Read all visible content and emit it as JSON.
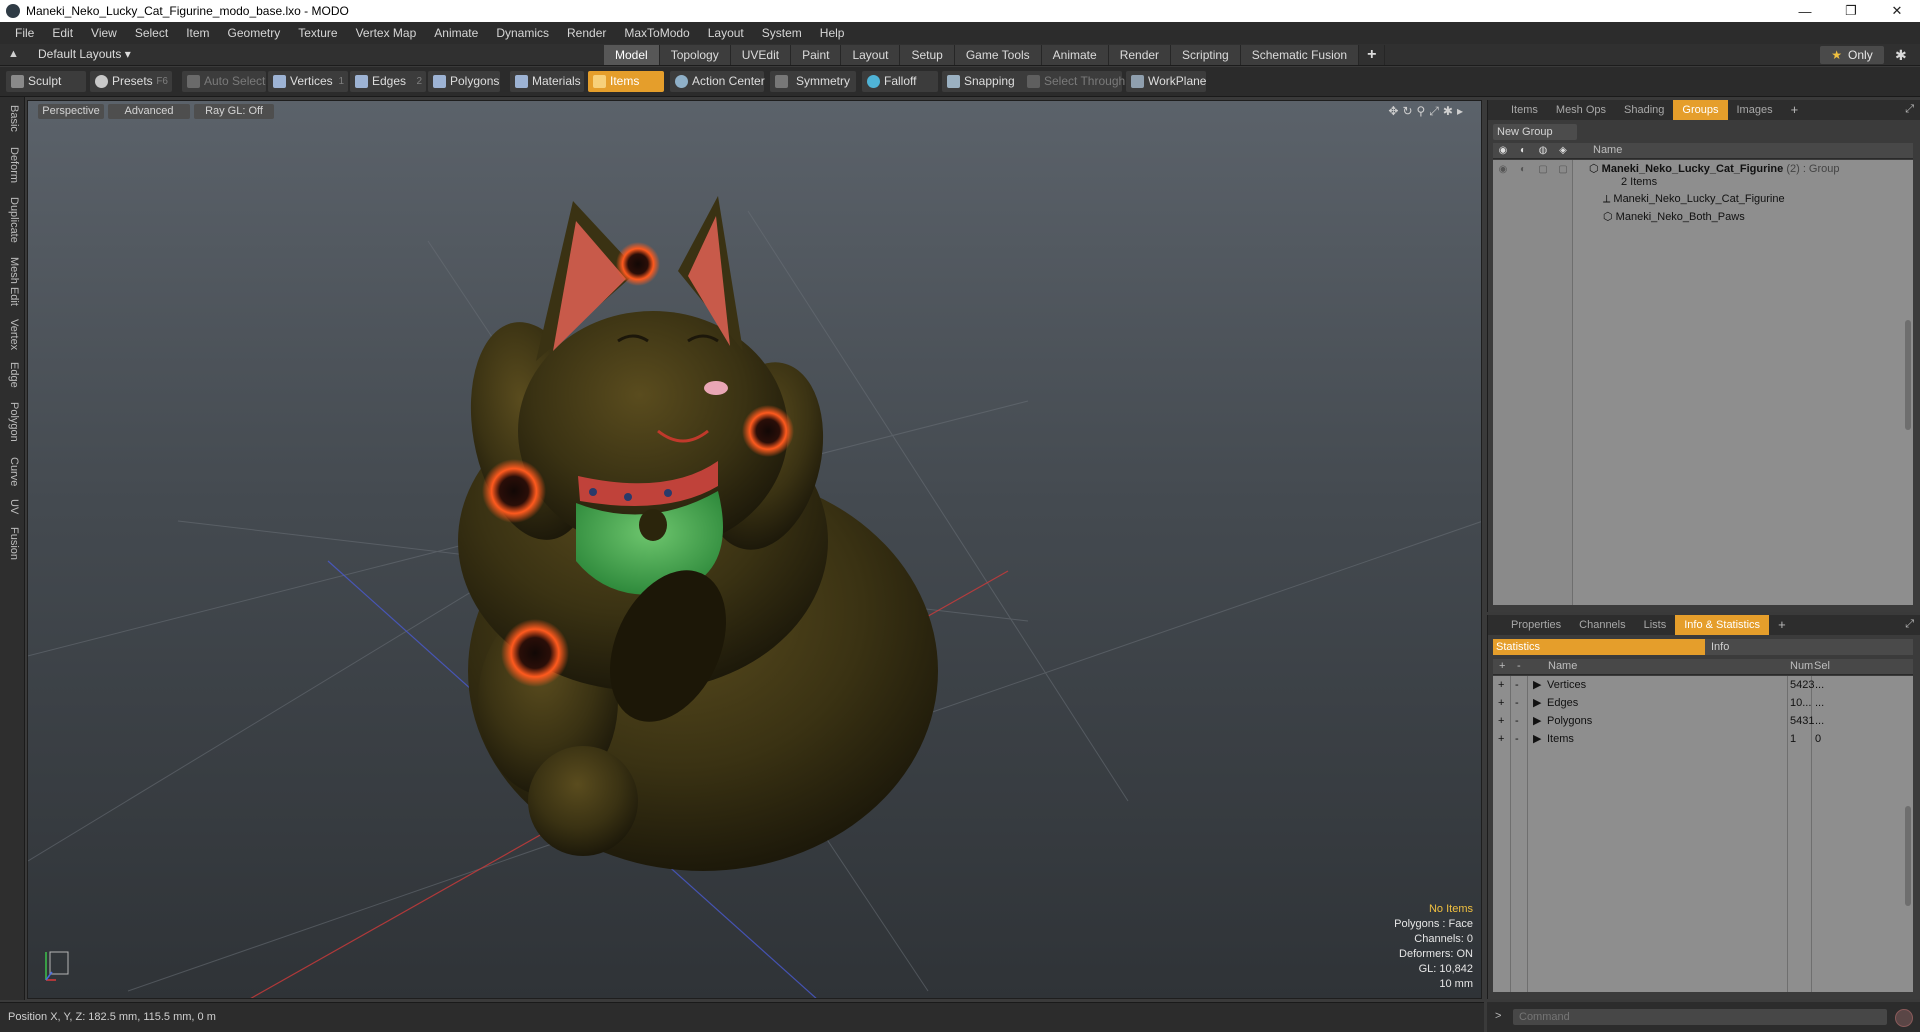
{
  "window": {
    "title": "Maneki_Neko_Lucky_Cat_Figurine_modo_base.lxo - MODO",
    "controls": [
      "—",
      "❐",
      "✕"
    ]
  },
  "menu": [
    "File",
    "Edit",
    "View",
    "Select",
    "Item",
    "Geometry",
    "Texture",
    "Vertex Map",
    "Animate",
    "Dynamics",
    "Render",
    "MaxToModo",
    "Layout",
    "System",
    "Help"
  ],
  "layoutbar": {
    "layout_dropdown": "Default Layouts ▾",
    "tabs": [
      "Model",
      "Topology",
      "UVEdit",
      "Paint",
      "Layout",
      "Setup",
      "Game Tools",
      "Animate",
      "Render",
      "Scripting",
      "Schematic Fusion"
    ],
    "active_tab": "Model",
    "add_tab": "+",
    "only_label": "Only"
  },
  "toolbar": {
    "sculpt": "Sculpt",
    "presets": "Presets",
    "presets_key": "F6",
    "auto_select": "Auto Select",
    "vertices": "Vertices",
    "vertices_key": "1",
    "edges": "Edges",
    "edges_key": "2",
    "polygons": "Polygons",
    "materials": "Materials",
    "items": "Items",
    "action_center": "Action Center",
    "symmetry": "Symmetry",
    "falloff": "Falloff",
    "snapping": "Snapping",
    "select_through": "Select Through",
    "workplane": "WorkPlane"
  },
  "left_tabs": [
    "Basic",
    "Deform",
    "Duplicate",
    "Mesh Edit",
    "Vertex",
    "Edge",
    "Polygon",
    "Curve",
    "UV",
    "Fusion"
  ],
  "viewport": {
    "view_mode": "Perspective",
    "shading": "Advanced",
    "raygl": "Ray GL: Off",
    "overlay": {
      "no_items": "No Items",
      "polygons": "Polygons : Face",
      "channels": "Channels: 0",
      "deformers": "Deformers: ON",
      "gl": "GL: 10,842",
      "scale": "10 mm"
    }
  },
  "groups_panel": {
    "tabs": [
      "Items",
      "Mesh Ops",
      "Shading",
      "Groups",
      "Images"
    ],
    "active_tab": "Groups",
    "add_tab": "+",
    "new_group": "New Group",
    "column_name": "Name",
    "rows": [
      {
        "name": "Maneki_Neko_Lucky_Cat_Figurine",
        "suffix": "(2) : Group",
        "sub": "2 Items"
      },
      {
        "name": "Maneki_Neko_Lucky_Cat_Figurine"
      },
      {
        "name": "Maneki_Neko_Both_Paws"
      }
    ]
  },
  "stats_panel": {
    "tabs": [
      "Properties",
      "Channels",
      "Lists",
      "Info & Statistics"
    ],
    "active_tab": "Info & Statistics",
    "add_tab": "+",
    "subtabs": [
      "Statistics",
      "Info"
    ],
    "columns": [
      "Name",
      "Num",
      "Sel"
    ],
    "rows": [
      {
        "name": "Vertices",
        "num": "5423",
        "sel": "..."
      },
      {
        "name": "Edges",
        "num": "10...",
        "sel": "..."
      },
      {
        "name": "Polygons",
        "num": "5431",
        "sel": "..."
      },
      {
        "name": "Items",
        "num": "1",
        "sel": "0"
      }
    ]
  },
  "status": {
    "position": "Position X, Y, Z:   182.5 mm, 115.5 mm, 0 m"
  },
  "command": {
    "prompt": ">",
    "placeholder": "Command"
  },
  "colors": {
    "accent": "#e59e2b",
    "cat_body": "#3a3213",
    "ear_inner": "#c85a4a",
    "bib": "#3e9e4a",
    "collar": "#c0423a",
    "paw_spot": "#ff5a1e"
  }
}
